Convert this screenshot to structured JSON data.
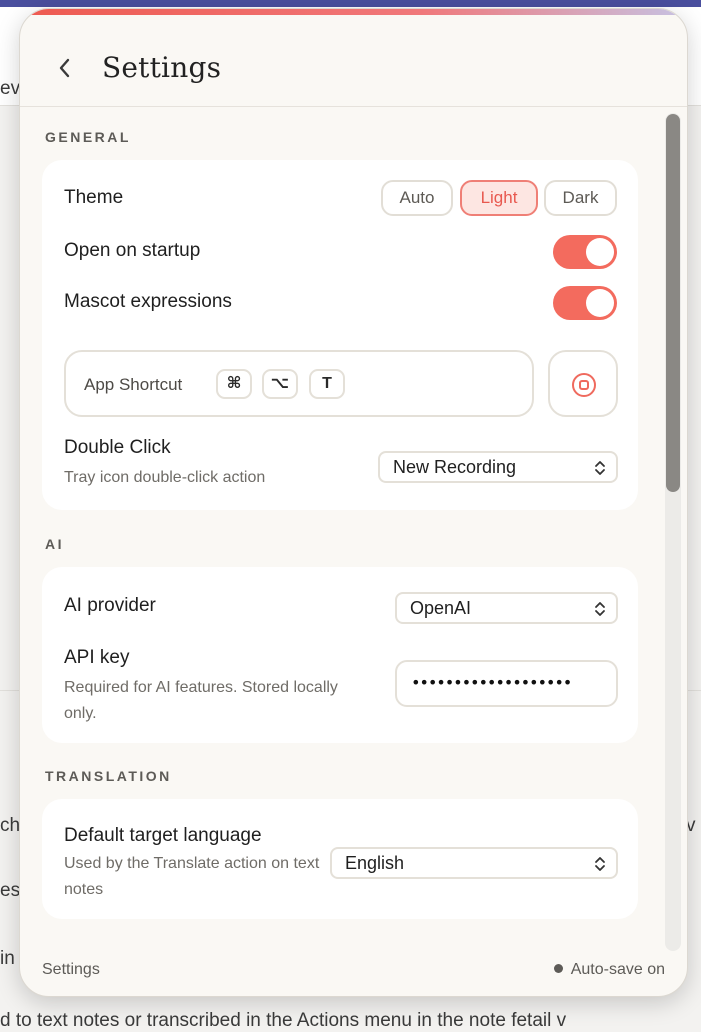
{
  "background": {
    "fragments": [
      "ev",
      "ch",
      "es",
      "in",
      "v"
    ],
    "bottom_text": "d to text notes or transcribed in the Actions menu in the note fetail v"
  },
  "header": {
    "title": "Settings",
    "back_icon": "chevron-left-icon"
  },
  "general": {
    "section_label": "GENERAL",
    "theme": {
      "label": "Theme",
      "options": [
        "Auto",
        "Light",
        "Dark"
      ],
      "selected": "Light"
    },
    "open_on_startup": {
      "label": "Open on startup",
      "enabled": true
    },
    "mascot_expressions": {
      "label": "Mascot expressions",
      "enabled": true
    },
    "app_shortcut": {
      "label": "App Shortcut",
      "keys": [
        "⌘",
        "⌥",
        "T"
      ],
      "record_icon": "record-icon"
    },
    "double_click": {
      "label": "Double Click",
      "sublabel": "Tray icon double-click action",
      "value": "New Recording"
    }
  },
  "ai": {
    "section_label": "AI",
    "provider": {
      "label": "AI provider",
      "value": "OpenAI"
    },
    "api_key": {
      "label": "API key",
      "sublabel": "Required for AI features. Stored locally only.",
      "value": "•••••••••••••••••••"
    }
  },
  "translation": {
    "section_label": "TRANSLATION",
    "target_language": {
      "label": "Default target language",
      "sublabel": "Used by the Translate action on text notes",
      "value": "English"
    }
  },
  "footer": {
    "left": "Settings",
    "status": "Auto-save on"
  },
  "colors": {
    "accent": "#f36b5e",
    "accent_light": "#fde6e2",
    "panel_bg": "#faf8f4",
    "card_bg": "#ffffff"
  }
}
